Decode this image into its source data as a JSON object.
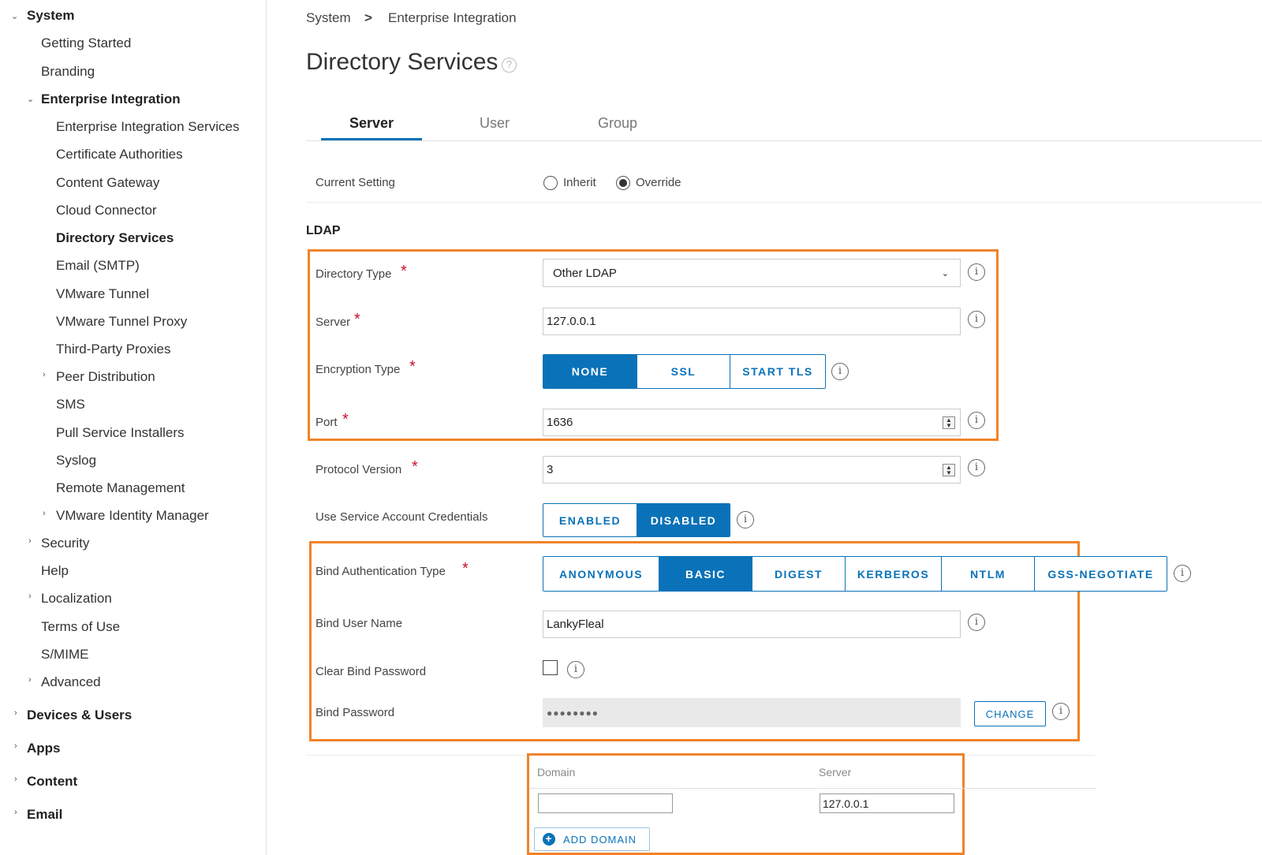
{
  "sidebar": {
    "items": [
      {
        "label": "System"
      },
      {
        "label": "Getting Started"
      },
      {
        "label": "Branding"
      },
      {
        "label": "Enterprise Integration"
      },
      {
        "label": "Enterprise Integration Services"
      },
      {
        "label": "Certificate Authorities"
      },
      {
        "label": "Content Gateway"
      },
      {
        "label": "Cloud Connector"
      },
      {
        "label": "Directory Services"
      },
      {
        "label": "Email (SMTP)"
      },
      {
        "label": "VMware Tunnel"
      },
      {
        "label": "VMware Tunnel Proxy"
      },
      {
        "label": "Third-Party Proxies"
      },
      {
        "label": "Peer Distribution"
      },
      {
        "label": "SMS"
      },
      {
        "label": "Pull Service Installers"
      },
      {
        "label": "Syslog"
      },
      {
        "label": "Remote Management"
      },
      {
        "label": "VMware Identity Manager"
      },
      {
        "label": "Security"
      },
      {
        "label": "Help"
      },
      {
        "label": "Localization"
      },
      {
        "label": "Terms of Use"
      },
      {
        "label": "S/MIME"
      },
      {
        "label": "Advanced"
      },
      {
        "label": "Devices & Users"
      },
      {
        "label": "Apps"
      },
      {
        "label": "Content"
      },
      {
        "label": "Email"
      }
    ]
  },
  "breadcrumb": {
    "root": "System",
    "separator": ">",
    "current": "Enterprise Integration"
  },
  "page": {
    "title": "Directory Services",
    "help_glyph": "?"
  },
  "tabs": [
    {
      "label": "Server"
    },
    {
      "label": "User"
    },
    {
      "label": "Group"
    }
  ],
  "current_setting": {
    "label": "Current Setting",
    "options": [
      {
        "label": "Inherit"
      },
      {
        "label": "Override"
      }
    ]
  },
  "ldap": {
    "section_title": "LDAP",
    "required_mark": "*",
    "info_glyph": "i",
    "directory_type": {
      "label": "Directory Type",
      "value": "Other LDAP"
    },
    "server": {
      "label": "Server",
      "value": "127.0.0.1"
    },
    "encryption_type": {
      "label": "Encryption Type",
      "options": [
        {
          "label": "NONE"
        },
        {
          "label": "SSL"
        },
        {
          "label": "START TLS"
        }
      ]
    },
    "port": {
      "label": "Port",
      "value": "1636"
    },
    "protocol_version": {
      "label": "Protocol Version",
      "value": "3"
    },
    "service_account": {
      "label": "Use Service Account Credentials",
      "options": [
        {
          "label": "ENABLED"
        },
        {
          "label": "DISABLED"
        }
      ]
    },
    "bind_auth_type": {
      "label": "Bind Authentication Type",
      "options": [
        {
          "label": "ANONYMOUS"
        },
        {
          "label": "BASIC"
        },
        {
          "label": "DIGEST"
        },
        {
          "label": "KERBEROS"
        },
        {
          "label": "NTLM"
        },
        {
          "label": "GSS-NEGOTIATE"
        }
      ]
    },
    "bind_user_name": {
      "label": "Bind User Name",
      "value": "LankyFleal"
    },
    "clear_bind_password": {
      "label": "Clear Bind Password"
    },
    "bind_password": {
      "label": "Bind Password",
      "value": "●●●●●●●●",
      "change_label": "CHANGE"
    }
  },
  "domains": {
    "headers": {
      "domain": "Domain",
      "server": "Server"
    },
    "rows": [
      {
        "domain": "",
        "server": "127.0.0.1"
      }
    ],
    "add_label": "ADD DOMAIN",
    "add_glyph": "+"
  },
  "colors": {
    "accent": "#0a72b8",
    "highlight": "#f0832a",
    "required": "#c8102e"
  }
}
